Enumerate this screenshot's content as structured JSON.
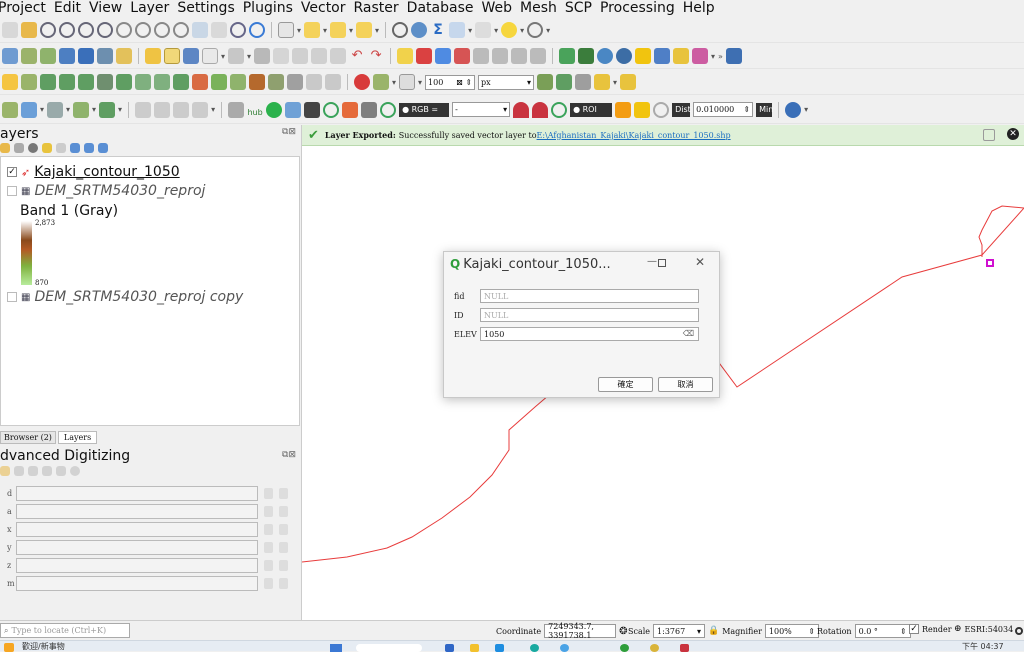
{
  "menu": [
    "Project",
    "Edit",
    "View",
    "Layer",
    "Settings",
    "Plugins",
    "Vector",
    "Raster",
    "Database",
    "Web",
    "Mesh",
    "SCP",
    "Processing",
    "Help"
  ],
  "toolbar": {
    "snap_tolerance": "100",
    "snap_units": "px",
    "rgb_label": "RGB =",
    "rgb_value": "-",
    "roi_label": "ROI",
    "dist_label": "Dist",
    "dist_value": "0.010000",
    "min_label": "Min",
    "hub_label": "hub"
  },
  "layers_panel": {
    "title": "ayers",
    "items": [
      {
        "name": "Kajaki_contour_1050",
        "checked": true
      },
      {
        "name": "DEM_SRTM54030_reproj",
        "checked": false
      },
      {
        "name": "DEM_SRTM54030_reproj copy",
        "checked": false
      }
    ],
    "band_label": "Band 1 (Gray)",
    "band_max": "2,873",
    "band_min": "870",
    "tabs": [
      "Browser (2)",
      "Layers"
    ]
  },
  "digitizing": {
    "title": "dvanced Digitizing",
    "fields": [
      "d",
      "a",
      "x",
      "y",
      "z",
      "m"
    ]
  },
  "message": {
    "label": "Layer Exported:",
    "text": "Successfully saved vector layer to ",
    "path": "E:\\Afghanistan_Kajaki\\Kajaki_contour_1050.shp"
  },
  "dialog": {
    "title": "Kajaki_contour_1050...",
    "fields": [
      {
        "label": "fid",
        "value": "",
        "placeholder": "NULL"
      },
      {
        "label": "ID",
        "value": "",
        "placeholder": "NULL"
      },
      {
        "label": "ELEV",
        "value": "1050",
        "placeholder": ""
      }
    ],
    "ok": "確定",
    "cancel": "取消"
  },
  "status": {
    "locate_placeholder": "Type to locate (Ctrl+K)",
    "coordinate_label": "Coordinate",
    "coordinate": "7249343.7, 3391738.1",
    "scale_label": "Scale",
    "scale": "1:3767",
    "magnifier_label": "Magnifier",
    "magnifier": "100%",
    "rotation_label": "Rotation",
    "rotation": "0.0 °",
    "render_label": "Render",
    "crs": "ESRI:54034"
  },
  "taskbar": {
    "left_text": "歡迎/新事物",
    "clock": "下午 04:37"
  },
  "colors": {
    "accent": "#1e88e5",
    "message_bg": "#dff0d8",
    "contour": "#e83c3c",
    "vertex": "#d010d0"
  }
}
